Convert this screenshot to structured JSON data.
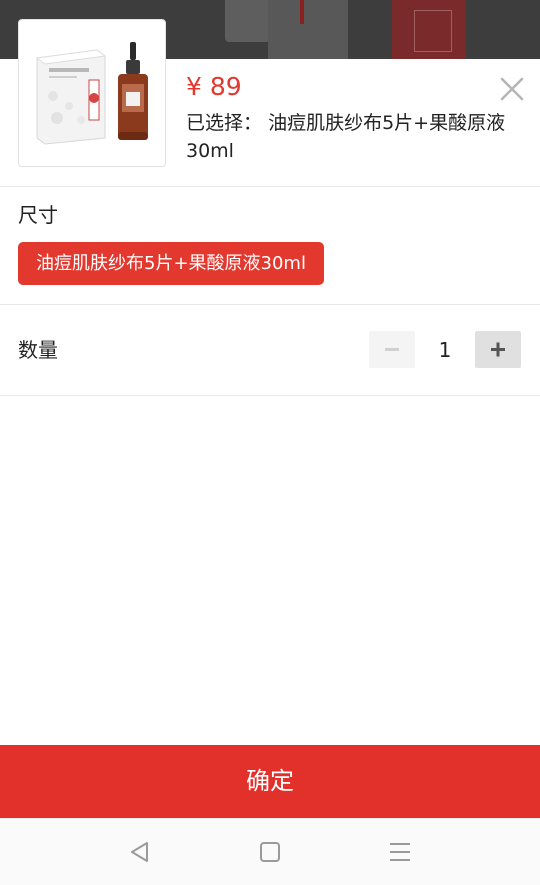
{
  "product": {
    "price": "¥ 89",
    "selected_prefix": "已选择：",
    "selected_value": "油痘肌肤纱布5片+果酸原液30ml",
    "thumbnail_icon": "product-thumbnail-icon"
  },
  "sheet": {
    "close_icon": "close-icon"
  },
  "size": {
    "title": "尺寸",
    "options": [
      {
        "label": "油痘肌肤纱布5片+果酸原液30ml",
        "selected": true
      }
    ]
  },
  "quantity": {
    "label": "数量",
    "value": "1",
    "minus_icon": "minus-icon",
    "plus_icon": "plus-icon"
  },
  "confirm": {
    "label": "确定"
  },
  "colors": {
    "accent": "#e2382e",
    "confirm_bg": "#e2302a"
  },
  "navbar": {
    "back_icon": "back-icon",
    "home_icon": "home-icon",
    "menu_icon": "menu-icon"
  }
}
